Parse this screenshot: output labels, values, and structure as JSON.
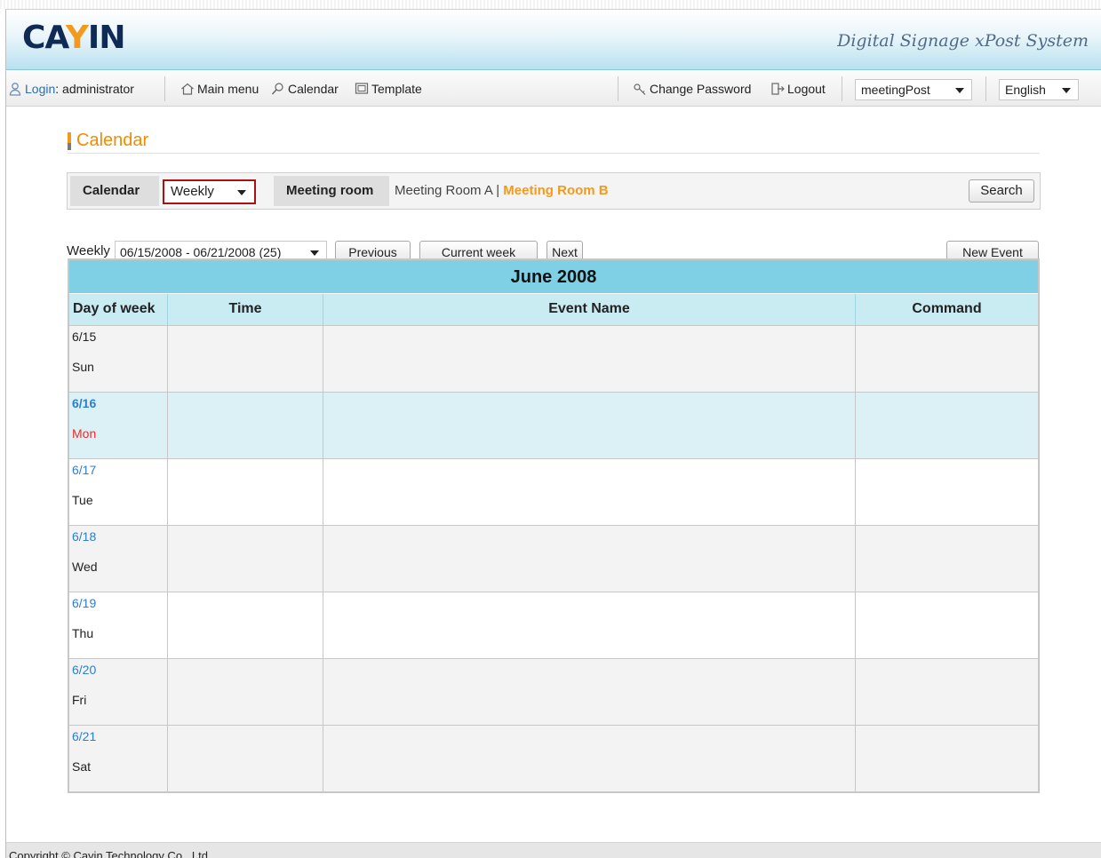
{
  "header": {
    "logo_prefix": "CA",
    "logo_mid": "Y",
    "logo_suffix": "IN",
    "tagline": "Digital Signage xPost System"
  },
  "navbar": {
    "login_label": "Login",
    "login_user": ": administrator",
    "main_menu": "Main menu",
    "calendar": "Calendar",
    "template": "Template",
    "change_password": "Change Password",
    "logout": "Logout",
    "app_select": "meetingPost",
    "language_select": "English"
  },
  "page": {
    "title": "Calendar"
  },
  "filter": {
    "calendar_label": "Calendar",
    "view_select": "Weekly",
    "meeting_room_label": "Meeting room",
    "room_a": "Meeting Room A",
    "room_sep": " | ",
    "room_b": "Meeting Room B",
    "search_button": "Search"
  },
  "week_nav": {
    "label": "Weekly",
    "week_select": "06/15/2008 - 06/21/2008 (25)",
    "previous": "Previous",
    "current_week": "Current week",
    "next": "Next",
    "new_event": "New Event"
  },
  "calendar": {
    "month": "June 2008",
    "columns": [
      "Day of week",
      "Time",
      "Event Name",
      "Command"
    ],
    "days": [
      {
        "date": "6/15",
        "name": "Sun"
      },
      {
        "date": "6/16",
        "name": "Mon"
      },
      {
        "date": "6/17",
        "name": "Tue"
      },
      {
        "date": "6/18",
        "name": "Wed"
      },
      {
        "date": "6/19",
        "name": "Thu"
      },
      {
        "date": "6/20",
        "name": "Fri"
      },
      {
        "date": "6/21",
        "name": "Sat"
      }
    ]
  },
  "footer": {
    "copyright": "Copyright © Cayin Technology Co., Ltd."
  },
  "colors": {
    "accent_orange": "#f39a1d",
    "header_blue": "#7fd0e4",
    "today_row": "#dcf1f6",
    "link_blue": "#2a7fd0",
    "weekend_red": "#e23030"
  }
}
